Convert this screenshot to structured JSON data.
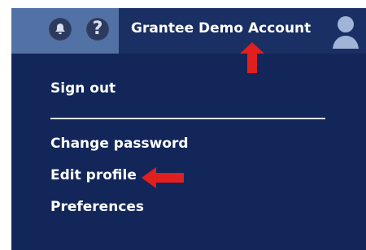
{
  "header": {
    "account_name": "Grantee Demo Account"
  },
  "icons": {
    "bell": "bell-icon",
    "help": "help-icon",
    "user": "user-avatar-icon",
    "annotation_up": "red-up-arrow-icon",
    "annotation_left": "red-left-arrow-icon"
  },
  "menu": {
    "sign_out": "Sign out",
    "change_password": "Change password",
    "edit_profile": "Edit profile",
    "preferences": "Preferences"
  },
  "colors": {
    "panel_bg": "#13265a",
    "header_bg": "#1a2f63",
    "icon_box_bg": "#5272a5",
    "text": "#ffffff",
    "accent_red": "#e11f1f"
  }
}
